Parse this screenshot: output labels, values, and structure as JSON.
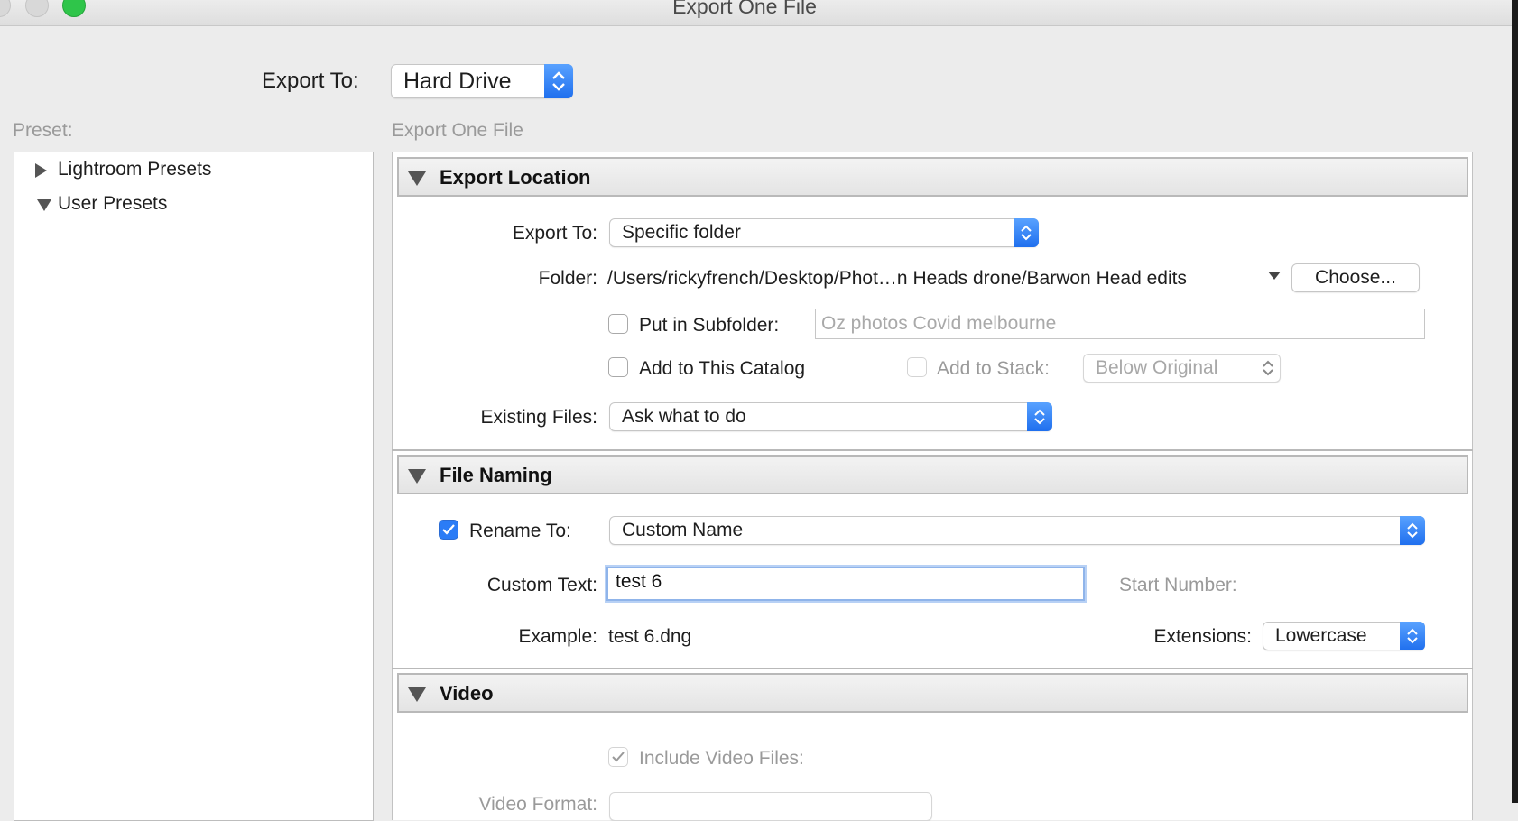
{
  "window": {
    "title": "Export One File"
  },
  "top": {
    "export_to_label": "Export To:",
    "export_to_value": "Hard Drive"
  },
  "preset": {
    "label": "Preset:",
    "items": [
      {
        "label": "Lightroom Presets",
        "expanded": false
      },
      {
        "label": "User Presets",
        "expanded": true
      }
    ]
  },
  "main": {
    "subtitle": "Export One File"
  },
  "export_location": {
    "title": "Export Location",
    "export_to_label": "Export To:",
    "export_to_value": "Specific folder",
    "folder_label": "Folder:",
    "folder_path": "/Users/rickyfrench/Desktop/Phot…n Heads drone/Barwon Head edits",
    "choose_button": "Choose...",
    "subfolder_label": "Put in Subfolder:",
    "subfolder_checked": false,
    "subfolder_placeholder": "Oz photos Covid melbourne",
    "add_catalog_label": "Add to This Catalog",
    "add_catalog_checked": false,
    "add_stack_label": "Add to Stack:",
    "add_stack_checked": false,
    "stack_position": "Below Original",
    "existing_files_label": "Existing Files:",
    "existing_files_value": "Ask what to do"
  },
  "file_naming": {
    "title": "File Naming",
    "rename_label": "Rename To:",
    "rename_checked": true,
    "rename_value": "Custom Name",
    "custom_text_label": "Custom Text:",
    "custom_text_value": "test 6",
    "start_number_label": "Start Number:",
    "example_label": "Example:",
    "example_value": "test 6.dng",
    "extensions_label": "Extensions:",
    "extensions_value": "Lowercase"
  },
  "video": {
    "title": "Video",
    "include_label": "Include Video Files:",
    "include_checked": true,
    "format_label": "Video Format:"
  },
  "colors": {
    "accent": "#2b7cf6",
    "close_button": "#2fc54a"
  }
}
